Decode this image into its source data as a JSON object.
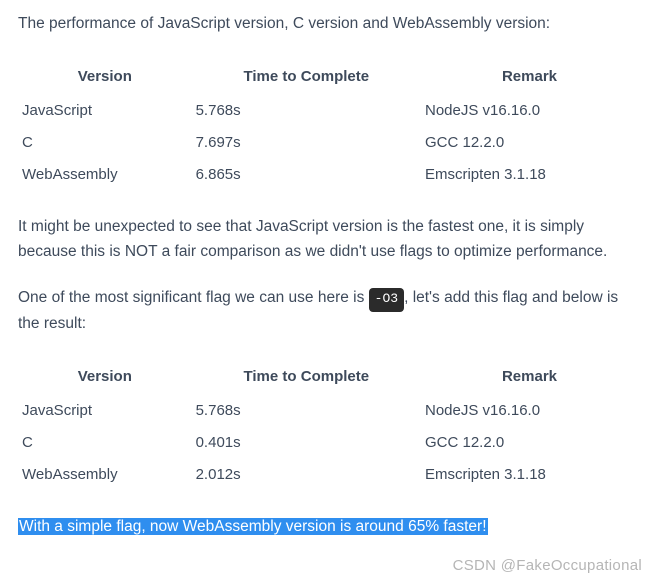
{
  "intro": "The performance of JavaScript version, C version and WebAssembly version:",
  "table1": {
    "headers": [
      "Version",
      "Time to Complete",
      "Remark"
    ],
    "rows": [
      [
        "JavaScript",
        "5.768s",
        "NodeJS v16.16.0"
      ],
      [
        "C",
        "7.697s",
        "GCC 12.2.0"
      ],
      [
        "WebAssembly",
        "6.865s",
        "Emscripten 3.1.18"
      ]
    ]
  },
  "para1": "It might be unexpected to see that JavaScript version is the fastest one, it is simply because this is NOT a fair comparison as we didn't use flags to optimize performance.",
  "para2_pre": "One of the most significant flag we can use here is ",
  "flag": "-O3",
  "para2_post": ", let's add this flag and below is the result:",
  "table2": {
    "headers": [
      "Version",
      "Time to Complete",
      "Remark"
    ],
    "rows": [
      [
        "JavaScript",
        "5.768s",
        "NodeJS v16.16.0"
      ],
      [
        "C",
        "0.401s",
        "GCC 12.2.0"
      ],
      [
        "WebAssembly",
        "2.012s",
        "Emscripten 3.1.18"
      ]
    ]
  },
  "highlighted": "With a simple flag, now WebAssembly version is around 65% faster!",
  "watermark": "CSDN @FakeOccupational"
}
